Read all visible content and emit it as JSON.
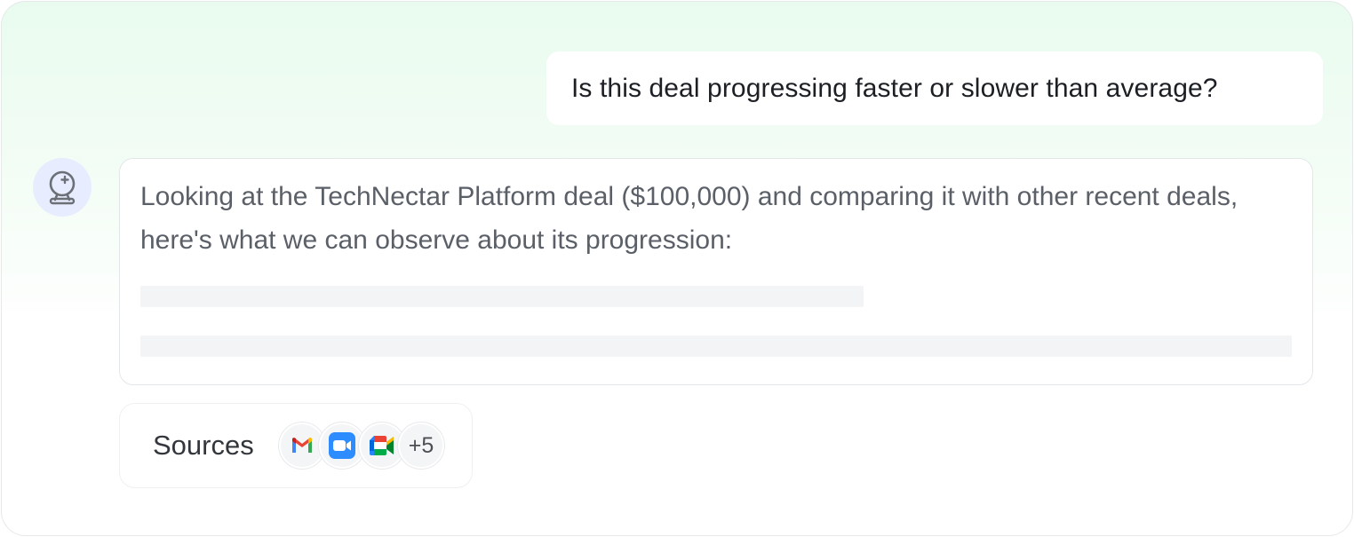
{
  "conversation": {
    "user_question": "Is this deal progressing faster or slower than average?",
    "assistant": {
      "avatar_icon": "assistant-bot-icon",
      "answer": "Looking at the TechNectar Platform deal ($100,000) and comparing it with other recent deals, here's what we can observe about its progression:",
      "loading": true
    }
  },
  "sources": {
    "label": "Sources",
    "icons": [
      "gmail-icon",
      "zoom-icon",
      "google-meet-icon"
    ],
    "more_count": "+5"
  },
  "colors": {
    "gmail_red": "#EA4335",
    "zoom_blue": "#2D8CFF",
    "meet_green": "#00AC47",
    "avatar_bg": "#E8ECFF",
    "card_gradient_top": "#E9FBEF"
  }
}
